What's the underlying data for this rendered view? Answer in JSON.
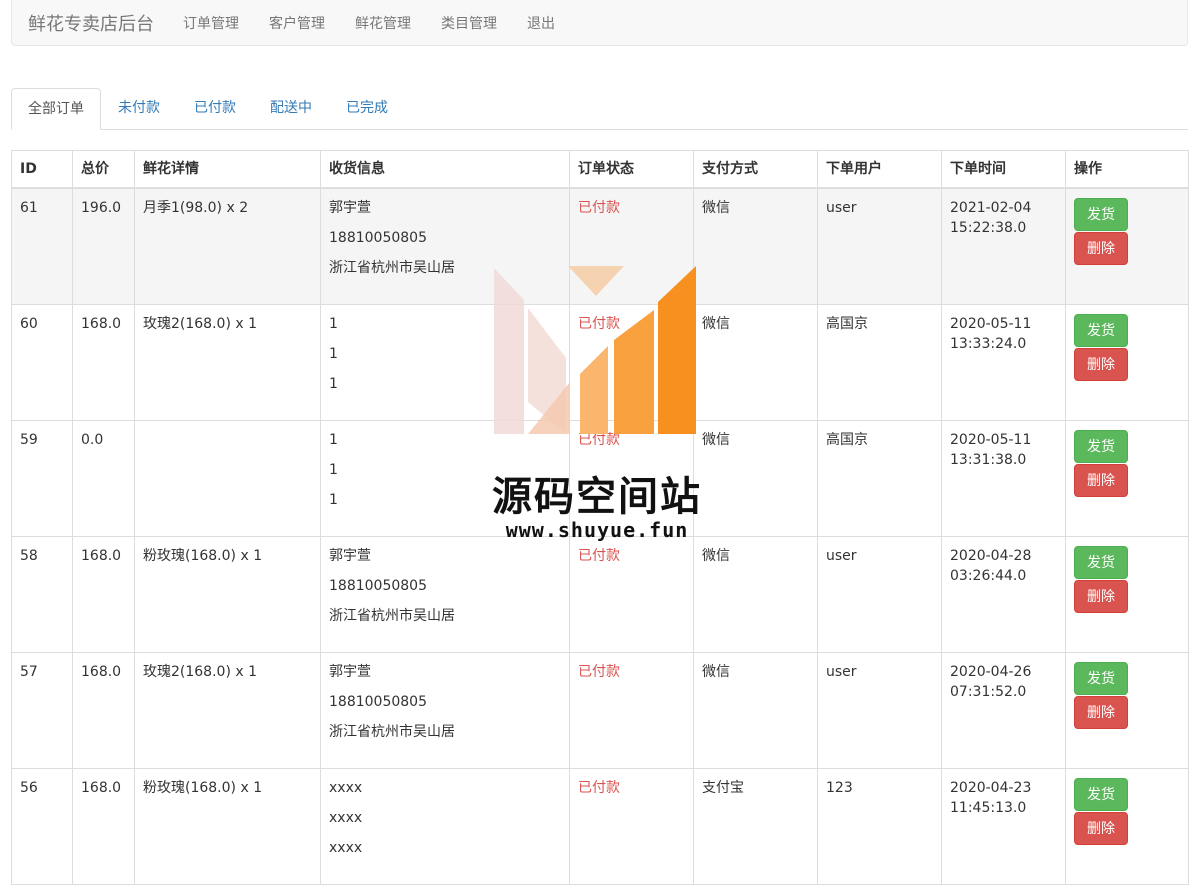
{
  "navbar": {
    "brand": "鲜花专卖店后台",
    "links": [
      "订单管理",
      "客户管理",
      "鲜花管理",
      "类目管理",
      "退出"
    ]
  },
  "tabs": [
    {
      "label": "全部订单",
      "active": true
    },
    {
      "label": "未付款",
      "active": false
    },
    {
      "label": "已付款",
      "active": false
    },
    {
      "label": "配送中",
      "active": false
    },
    {
      "label": "已完成",
      "active": false
    }
  ],
  "table": {
    "headers": [
      "ID",
      "总价",
      "鲜花详情",
      "收货信息",
      "订单状态",
      "支付方式",
      "下单用户",
      "下单时间",
      "操作"
    ],
    "ship_label": "发货",
    "delete_label": "删除",
    "rows": [
      {
        "id": "61",
        "total": "196.0",
        "detail": "月季1(98.0) x 2",
        "name": "郭宇萱",
        "phone": "18810050805",
        "address": "浙江省杭州市吴山居",
        "status": "已付款",
        "pay": "微信",
        "user": "user",
        "date": "2021-02-04",
        "time": "15:22:38.0"
      },
      {
        "id": "60",
        "total": "168.0",
        "detail": "玫瑰2(168.0) x 1",
        "name": "1",
        "phone": "1",
        "address": "1",
        "status": "已付款",
        "pay": "微信",
        "user": "高国京",
        "date": "2020-05-11",
        "time": "13:33:24.0"
      },
      {
        "id": "59",
        "total": "0.0",
        "detail": "",
        "name": "1",
        "phone": "1",
        "address": "1",
        "status": "已付款",
        "pay": "微信",
        "user": "高国京",
        "date": "2020-05-11",
        "time": "13:31:38.0"
      },
      {
        "id": "58",
        "total": "168.0",
        "detail": "粉玫瑰(168.0) x 1",
        "name": "郭宇萱",
        "phone": "18810050805",
        "address": "浙江省杭州市吴山居",
        "status": "已付款",
        "pay": "微信",
        "user": "user",
        "date": "2020-04-28",
        "time": "03:26:44.0"
      },
      {
        "id": "57",
        "total": "168.0",
        "detail": "玫瑰2(168.0) x 1",
        "name": "郭宇萱",
        "phone": "18810050805",
        "address": "浙江省杭州市吴山居",
        "status": "已付款",
        "pay": "微信",
        "user": "user",
        "date": "2020-04-26",
        "time": "07:31:52.0"
      },
      {
        "id": "56",
        "total": "168.0",
        "detail": "粉玫瑰(168.0) x 1",
        "name": "xxxx",
        "phone": "xxxx",
        "address": "xxxx",
        "status": "已付款",
        "pay": "支付宝",
        "user": "123",
        "date": "2020-04-23",
        "time": "11:45:13.0"
      }
    ]
  },
  "watermark": {
    "title": "源码空间站",
    "url": "www.shuyue.fun"
  },
  "colors": {
    "status_red": "#d9534f",
    "ship_green": "#5cb85c",
    "delete_red": "#d9534f",
    "link_blue": "#337ab7",
    "watermark_orange": "#f7901e"
  }
}
